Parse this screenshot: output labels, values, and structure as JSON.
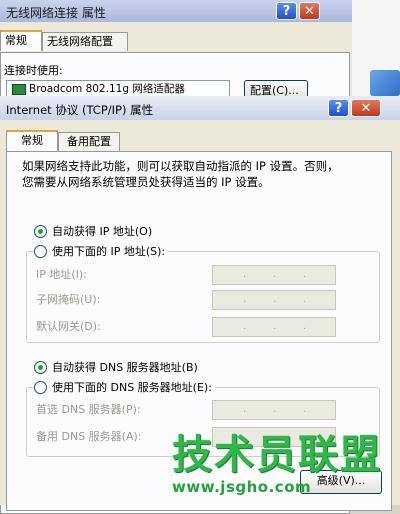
{
  "back_window": {
    "title": "无线网络连接 属性",
    "help_btn": "?",
    "close_btn": "✕",
    "tabs": [
      {
        "label": "常规"
      },
      {
        "label": "无线网络配置"
      }
    ],
    "connect_label": "连接时使用:",
    "adapter": "Broadcom 802.11g 网络适配器",
    "config_button": "配置(C)..."
  },
  "dialog": {
    "title": "Internet 协议 (TCP/IP) 属性",
    "help_btn": "?",
    "close_btn": "✕",
    "tabs": [
      {
        "label": "常规"
      },
      {
        "label": "备用配置"
      }
    ],
    "description_line1": "如果网络支持此功能，则可以获取自动指派的 IP 设置。否则，",
    "description_line2": "您需要从网络系统管理员处获得适当的 IP 设置。",
    "auto_ip": "自动获得 IP 地址(O)",
    "manual_ip": "使用下面的 IP 地址(S):",
    "ip_fields": [
      {
        "label": "IP 地址(I):"
      },
      {
        "label": "子网掩码(U):"
      },
      {
        "label": "默认网关(D):"
      }
    ],
    "auto_dns": "自动获得 DNS 服务器地址(B)",
    "manual_dns": "使用下面的 DNS 服务器地址(E):",
    "dns_fields": [
      {
        "label": "首选 DNS 服务器(P):"
      },
      {
        "label": "备用 DNS 服务器(A):"
      }
    ],
    "dot": ".",
    "bottom_button": "高级(V)..."
  },
  "watermark": {
    "brand": "技术员联盟",
    "url": "www.jsgho.com"
  }
}
